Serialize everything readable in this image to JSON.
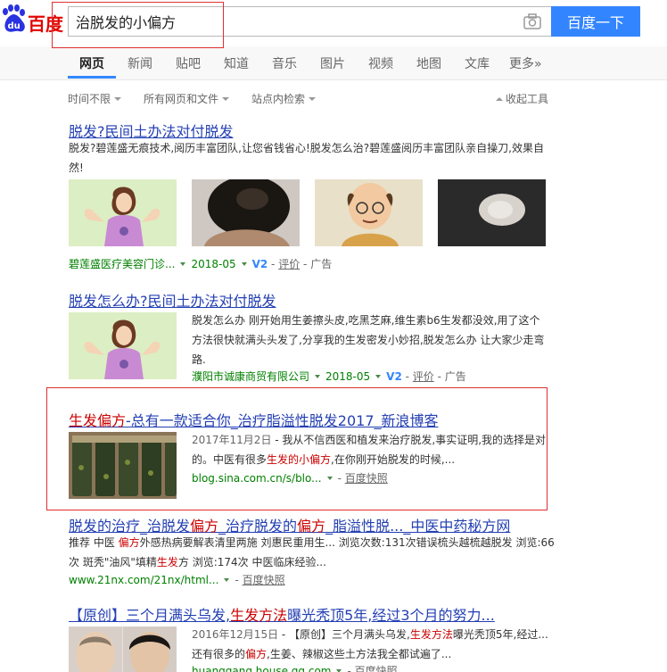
{
  "header": {
    "logo_text": "百度",
    "search_value": "治脱发的小偏方",
    "search_button": "百度一下"
  },
  "nav": {
    "tabs": [
      "网页",
      "新闻",
      "贴吧",
      "知道",
      "音乐",
      "图片",
      "视频",
      "地图",
      "文库",
      "更多»"
    ]
  },
  "tools": {
    "time": "时间不限",
    "filetype": "所有网页和文件",
    "site": "站点内检索",
    "collapse": "收起工具"
  },
  "results": [
    {
      "title": "脱发?民间土办法对付脱发",
      "desc": "脱发?碧莲盛无痕技术,阅历丰富团队,让您省钱省心!脱发怎么治?碧莲盛阅历丰富团队亲自操刀,效果自然!",
      "source": "碧莲盛医疗美容门诊...",
      "date": "2018-05",
      "v2": "V2",
      "review": "评价",
      "ad": "广告"
    },
    {
      "title": "脱发怎么办?民间土办法对付脱发",
      "desc": "脱发怎么办 刚开始用生姜擦头皮,吃黑芝麻,维生素b6生发都没效,用了这个方法很快就满头头发了,分享我的生发密发小妙招,脱发怎么办 让大家少走弯路.",
      "source": "濮阳市诚康商贸有限公司",
      "date": "2018-05",
      "v2": "V2",
      "review": "评价",
      "ad": "广告"
    },
    {
      "title_hl": "生发偏方",
      "title_rest": "-总有一款适合你_治疗脂溢性脱发2017_新浪博客",
      "date": "2017年11月2日",
      "desc_a": " - 我从不信西医和植发来治疗脱发,事实证明,我的选择是对的。中医有很多",
      "desc_hl": "生发的小偏方",
      "desc_b": ",在你刚开始脱发的时候,...",
      "url": "blog.sina.com.cn/s/blo...",
      "cache": "百度快照"
    },
    {
      "title_1": "脱发的治疗_治脱发",
      "title_hl1": "偏方",
      "title_2": "_治疗脱发的",
      "title_hl2": "偏方",
      "title_3": "_脂溢性脱..._中医中药秘方网",
      "desc_1": "推荐 中医 ",
      "desc_hl1": "偏方",
      "desc_2": "外感热病要解表清里两施 刘惠民重用生... 浏览次数:131次错误梳头越梳越脱发 浏览:66次 斑秃\"油风\"填精",
      "desc_hl2": "生发",
      "desc_3": "方 浏览:174次 中医临床经验...",
      "url": "www.21nx.com/21nx/html...",
      "cache": "百度快照"
    },
    {
      "title_1": "【原创】三个月满头乌发,",
      "title_hl": "生发方法",
      "title_2": "曝光秃顶5年,经过3个月的努力...",
      "date": "2016年12月15日",
      "desc_1": " - 【原创】三个月满头乌发,",
      "desc_hl1": "生发方法",
      "desc_2": "曝光秃顶5年,经过...还有很多的",
      "desc_hl2": "偏方",
      "desc_3": ",生姜、辣椒这些土方法我全都试遍了...",
      "url": "huanggang.house.qq.com",
      "cache": "百度快照"
    }
  ]
}
